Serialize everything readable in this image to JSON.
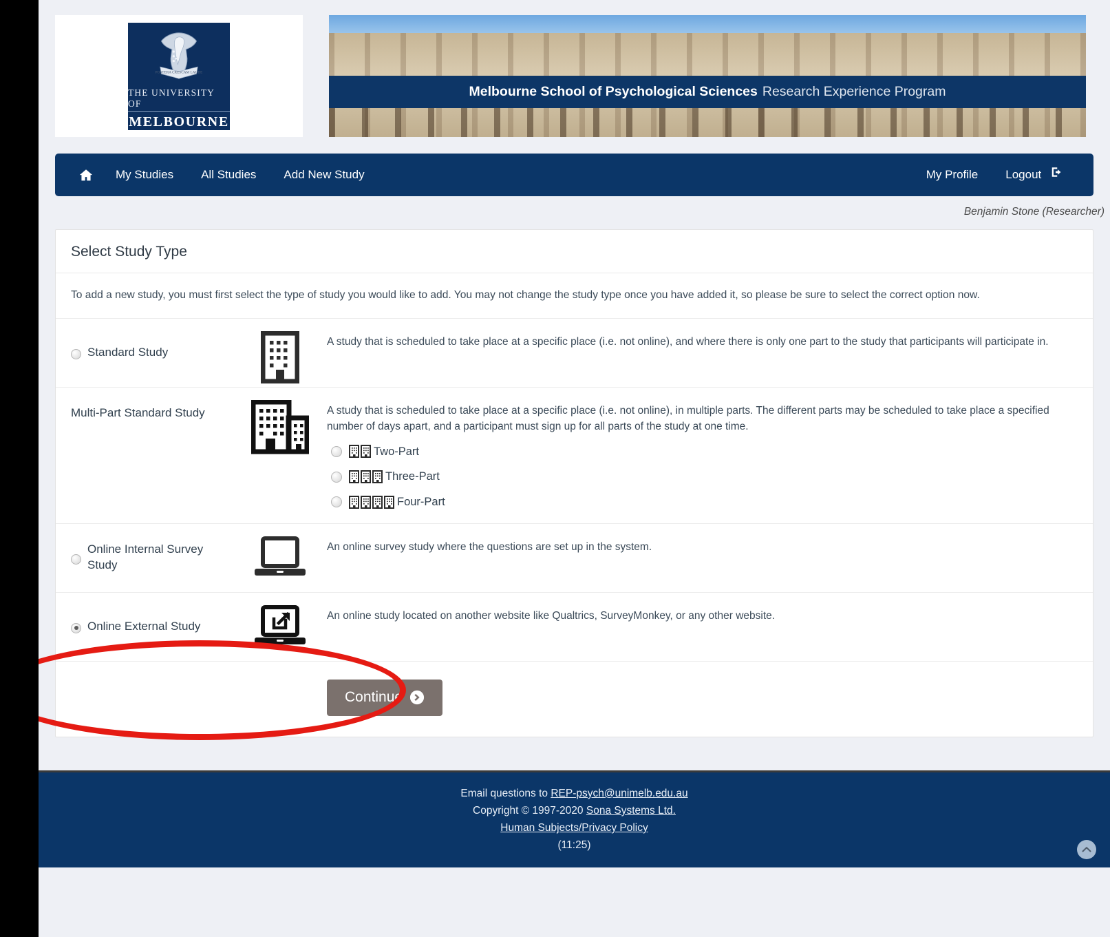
{
  "logo": {
    "line1": "THE UNIVERSITY OF",
    "line2": "MELBOURNE",
    "crest_alt": "university-crest"
  },
  "banner": {
    "title_bold": "Melbourne School of Psychological Sciences",
    "title_regular": "Research Experience Program"
  },
  "nav": {
    "home_icon": "home-icon",
    "items": [
      {
        "label": "My Studies"
      },
      {
        "label": "All Studies"
      },
      {
        "label": "Add New Study"
      }
    ],
    "right_items": [
      {
        "label": "My Profile"
      },
      {
        "label": "Logout"
      }
    ],
    "logout_icon": "logout-icon"
  },
  "user_line": "Benjamin Stone (Researcher)",
  "panel": {
    "title": "Select Study Type",
    "intro": "To add a new study, you must first select the type of study you would like to add. You may not change the study type once you have added it, so please be sure to select the correct option now.",
    "options": [
      {
        "label": "Standard Study",
        "icon": "single-building-icon",
        "selected": false,
        "description": "A study that is scheduled to take place at a specific place (i.e. not online), and where there is only one part to the study that participants will participate in."
      },
      {
        "label": "Multi-Part Standard Study",
        "icon": "two-buildings-icon",
        "selected": false,
        "description": "A study that is scheduled to take place at a specific place (i.e. not online), in multiple parts. The different parts may be scheduled to take place a specified number of days apart, and a participant must sign up for all parts of the study at one time.",
        "sub_options": [
          {
            "label": "Two-Part",
            "buildings": 2,
            "selected": false
          },
          {
            "label": "Three-Part",
            "buildings": 3,
            "selected": false
          },
          {
            "label": "Four-Part",
            "buildings": 4,
            "selected": false
          }
        ]
      },
      {
        "label": "Online Internal Survey Study",
        "icon": "laptop-icon",
        "selected": false,
        "description": "An online survey study where the questions are set up in the system."
      },
      {
        "label": "Online External Study",
        "icon": "laptop-external-link-icon",
        "selected": true,
        "description": "An online study located on another website like Qualtrics, SurveyMonkey, or any other website."
      }
    ],
    "continue_label": "Continue",
    "continue_icon": "chevron-right-circle-icon"
  },
  "footer": {
    "email_prefix": "Email questions to ",
    "email_link": "REP-psych@unimelb.edu.au",
    "copyright_prefix": "Copyright © 1997-2020 ",
    "copyright_link": "Sona Systems Ltd.",
    "privacy_link": "Human Subjects/Privacy Policy",
    "time": "(11:25)",
    "to_top_icon": "chevron-up-icon"
  },
  "annotation": {
    "shape": "red-ellipse-highlight",
    "color": "#e51b13",
    "target": "Online External Study"
  },
  "colors": {
    "navy": "#0b3668",
    "page_bg": "#eef0f5",
    "button": "#7b716d",
    "annotation_red": "#e51b13"
  }
}
